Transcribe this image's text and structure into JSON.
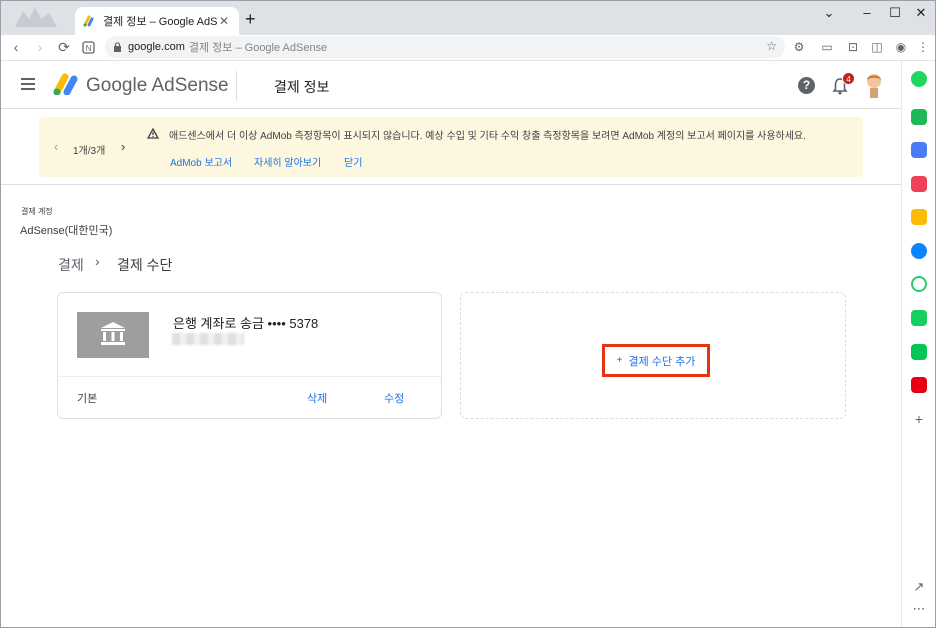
{
  "browser": {
    "tab_title": "결제 정보 – Google AdSense",
    "url_host": "google.com",
    "url_rest": "결제 정보 – Google AdSense"
  },
  "header": {
    "brand": "Google AdSense",
    "page_title": "결제 정보",
    "notification_count": "4",
    "help_glyph": "?"
  },
  "banner": {
    "pager": "1개/3개",
    "message": "애드센스에서 더 이상 AdMob 측정항목이 표시되지 않습니다. 예상 수입 및 기타 수익 창출 측정항목을 보려면 AdMob 계정의 보고서 페이지를 사용하세요.",
    "links": [
      "AdMob 보고서",
      "자세히 알아보기",
      "닫기"
    ]
  },
  "account": {
    "label": "결제 계정",
    "name": "AdSense(대한민국)"
  },
  "breadcrumb": {
    "parent": "결제",
    "current": "결제 수단"
  },
  "payment_card": {
    "title": "은행 계좌로 송금 •••• 5378",
    "default_label": "기본",
    "delete_label": "삭제",
    "edit_label": "수정"
  },
  "add_payment": {
    "label": "결제 수단 추가"
  },
  "colors": {
    "accent_blue": "#1a73e8",
    "highlight_red": "#e63312",
    "banner_bg": "#fef7e0",
    "badge_red": "#c5221f"
  }
}
